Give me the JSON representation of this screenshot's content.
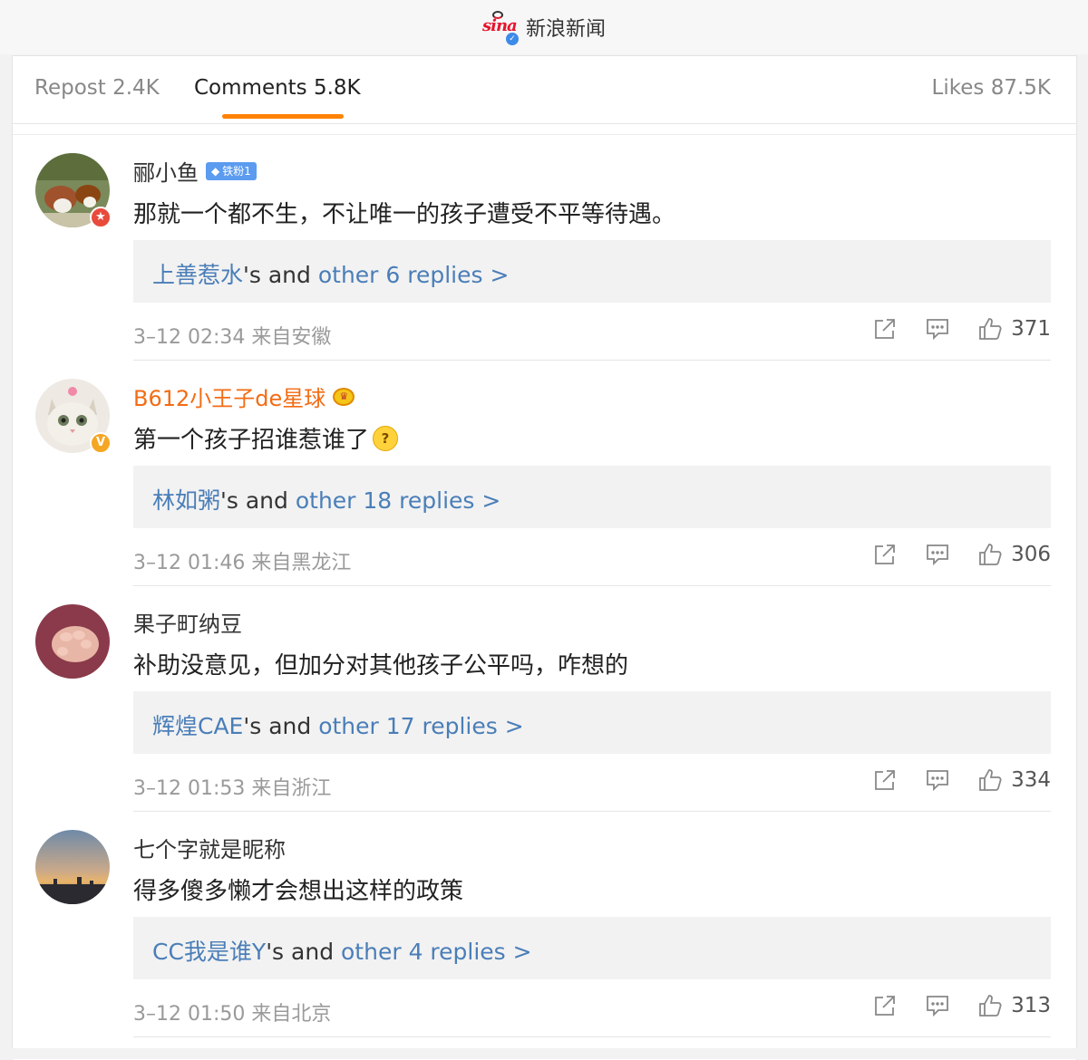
{
  "header": {
    "logo_text": "sina",
    "title": "新浪新闻"
  },
  "tabs": {
    "repost": "Repost 2.4K",
    "comments": "Comments 5.8K",
    "likes": "Likes 87.5K"
  },
  "colors": {
    "accent": "#ff8200",
    "link_blue": "#4a7eb8",
    "vip_orange": "#f26c14"
  },
  "comments": [
    {
      "username": "郦小鱼",
      "fan_badge": "铁粉1",
      "text": "那就一个都不生，不让唯一的孩子遭受不平等待遇。",
      "reply_user": "上善惹水",
      "reply_mid": "'s and ",
      "reply_count": "other 6 replies >",
      "meta": "3–12 02:34 来自安徽",
      "likes": "371"
    },
    {
      "username": "B612小王子de星球",
      "text": "第一个孩子招谁惹谁了",
      "reply_user": "林如粥",
      "reply_mid": "'s and ",
      "reply_count": "other 18 replies >",
      "meta": "3–12 01:46 来自黑龙江",
      "likes": "306"
    },
    {
      "username": "果子町纳豆",
      "text": "补助没意见，但加分对其他孩子公平吗，咋想的",
      "reply_user": "辉煌CAE",
      "reply_mid": "'s and ",
      "reply_count": "other 17 replies >",
      "meta": "3–12 01:53 来自浙江",
      "likes": "334"
    },
    {
      "username": "七个字就是昵称",
      "text": "得多傻多懒才会想出这样的政策",
      "reply_user": "CC我是谁Y",
      "reply_mid": "'s and ",
      "reply_count": "other 4 replies >",
      "meta": "3–12 01:50 来自北京",
      "likes": "313"
    }
  ],
  "icons": {
    "share": "share-icon",
    "comment": "comment-icon",
    "like": "thumbs-up-icon",
    "verified": "verified-icon",
    "emoji": "thinking-face-emoji"
  }
}
